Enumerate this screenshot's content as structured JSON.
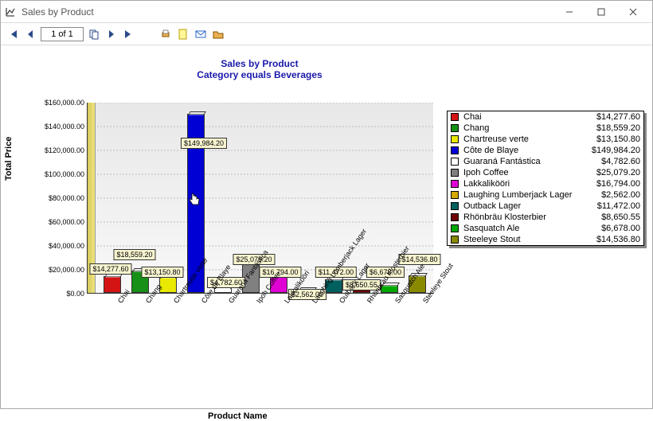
{
  "window": {
    "title": "Sales by Product"
  },
  "toolbar": {
    "page": "1 of 1"
  },
  "chart_data": {
    "type": "bar",
    "title": "Sales by Product",
    "subtitle": "Category equals Beverages",
    "xlabel": "Product Name",
    "ylabel": "Total Price",
    "ylim": [
      0,
      160000
    ],
    "yticks": [
      "$0.00",
      "$20,000.00",
      "$40,000.00",
      "$60,000.00",
      "$80,000.00",
      "$100,000.00",
      "$120,000.00",
      "$140,000.00",
      "$160,000.00"
    ],
    "categories": [
      "Chai",
      "Chang",
      "Chartreuse verte",
      "Côte de Blaye",
      "Guaraná Fantástica",
      "Ipoh Coffee",
      "Lakkalikööri",
      "Laughing Lumberjack Lager",
      "Outback Lager",
      "Rhönbräu Klosterbier",
      "Sasquatch Ale",
      "Steeleye Stout"
    ],
    "values": [
      14277.6,
      18559.2,
      13150.8,
      149984.2,
      4782.6,
      25079.2,
      16794.0,
      2562.0,
      11472.0,
      8650.55,
      6678.0,
      14536.8
    ],
    "value_labels": [
      "$14,277.60",
      "$18,559.20",
      "$13,150.80",
      "$149,984.20",
      "$4,782.60",
      "$25,079.20",
      "$16,794.00",
      "$2,562.00",
      "$11,472.00",
      "$8,650.55",
      "$6,678.00",
      "$14,536.80"
    ],
    "colors": [
      "#d41414",
      "#169016",
      "#e8e800",
      "#0000d4",
      "#ffffff",
      "#808080",
      "#e000d4",
      "#d4a800",
      "#006060",
      "#700000",
      "#00a800",
      "#8a8a00"
    ]
  },
  "legend_labels": {
    "0": "Chai",
    "1": "Chang",
    "2": "Chartreuse verte",
    "3": "Côte de Blaye",
    "4": "Guaraná Fantástica",
    "5": "Ipoh Coffee",
    "6": "Lakkalikööri",
    "7": "Laughing Lumberjack Lager",
    "8": "Outback Lager",
    "9": "Rhönbräu Klosterbier",
    "10": "Sasquatch Ale",
    "11": "Steeleye Stout"
  },
  "legend_values": {
    "0": "$14,277.60",
    "1": "$18,559.20",
    "2": "$13,150.80",
    "3": "$149,984.20",
    "4": "$4,782.60",
    "5": "$25,079.20",
    "6": "$16,794.00",
    "7": "$2,562.00",
    "8": "$11,472.00",
    "9": "$8,650.55",
    "10": "$6,678.00",
    "11": "$14,536.80"
  }
}
